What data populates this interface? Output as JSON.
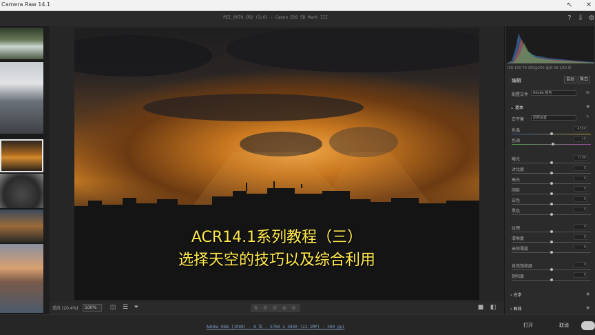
{
  "window": {
    "title": "Camera Raw 14.1"
  },
  "file": {
    "name_info": "PEI_0079.CR2 (3/6) - Canon EOS 5D Mark III"
  },
  "filmstrip": {
    "thumbnails": [
      "waterfall-photo",
      "buildings-photo",
      "sunset-skyline-photo",
      "tree-silhouette-photo",
      "dusk-clouds-photo",
      "coastal-sunset-photo"
    ]
  },
  "caption": {
    "line1": "ACR14.1系列教程（三）",
    "line2": "选择天空的技巧以及综合利用"
  },
  "bottombar": {
    "fit_label": "适应 (20.4%)",
    "zoom_value": "100%",
    "rating_stars": "☆ ☆ ☆ ☆ ☆"
  },
  "statusbar": {
    "info": "Adobe RGB (1998) - 8 位 - 5760 x 3840 (22.1MP) - 300 ppi",
    "open_label": "打开",
    "cancel_label": "取消"
  },
  "panel": {
    "metadata": "ISO 100   70-200@200 毫米   f/8   1/10 秒",
    "edit_label": "编辑",
    "auto_label": "自动",
    "bw_label": "黑白",
    "profile_label": "配置文件",
    "profile_value": "Adobe 颜色",
    "basic_label": "基本",
    "wb_label": "白平衡",
    "wb_value": "原照设置",
    "rows": [
      {
        "label": "色温",
        "value": "4550"
      },
      {
        "label": "色调",
        "value": "+5"
      },
      {
        "label": "曝光",
        "value": "0.00"
      },
      {
        "label": "对比度",
        "value": "0"
      },
      {
        "label": "高光",
        "value": "0"
      },
      {
        "label": "阴影",
        "value": "0"
      },
      {
        "label": "白色",
        "value": "0"
      },
      {
        "label": "黑色",
        "value": "0"
      },
      {
        "label": "纹理",
        "value": "0"
      },
      {
        "label": "清晰度",
        "value": "0"
      },
      {
        "label": "去除薄雾",
        "value": "0"
      },
      {
        "label": "自然饱和度",
        "value": "0"
      },
      {
        "label": "饱和度",
        "value": "0"
      }
    ],
    "curve_label": "光学",
    "tone_curve_label": "曲线"
  }
}
